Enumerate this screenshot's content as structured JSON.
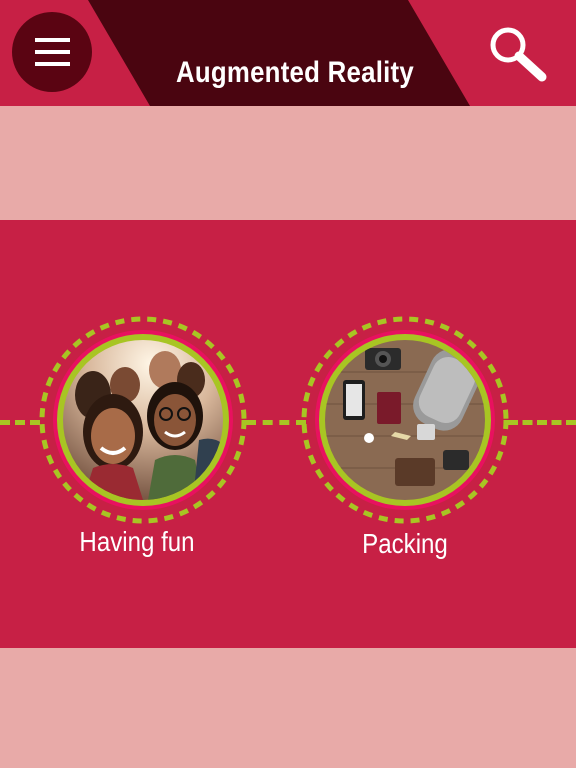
{
  "header": {
    "title": "Augmented Reality",
    "menu_icon": "hamburger-menu-icon",
    "search_icon": "search-icon"
  },
  "colors": {
    "primary": "#c72045",
    "light_band": "#e8aaa8",
    "dark_accent": "#4a0510",
    "lime": "#a8c523"
  },
  "items": [
    {
      "label": "Having fun",
      "image": "group-of-friends-photo"
    },
    {
      "label": "Packing",
      "image": "travel-packing-flatlay-photo"
    }
  ]
}
